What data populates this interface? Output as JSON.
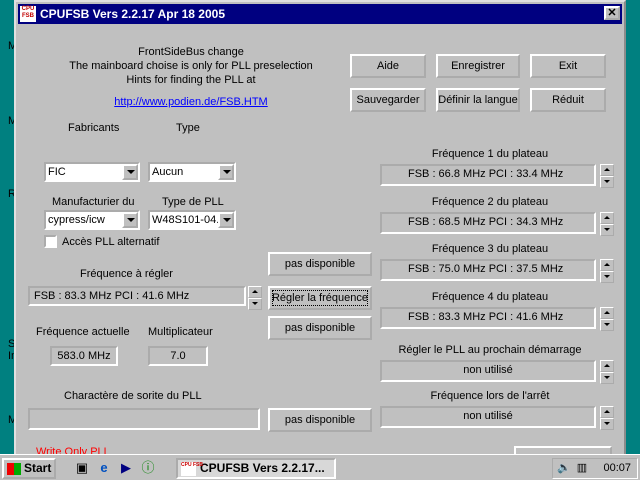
{
  "desktop": {
    "labels": [
      "My",
      "M",
      "R",
      "S",
      "In",
      "M"
    ]
  },
  "window": {
    "icon_text": "CPU FSB",
    "title": "CPUFSB  Vers 2.2.17   Apr 18 2005",
    "close_glyph": "✕"
  },
  "intro": {
    "line1": "FrontSideBus change",
    "line2": "The mainboard choise is only for PLL preselection",
    "line3": "Hints for finding the PLL at",
    "link": "http://www.podien.de/FSB.HTM"
  },
  "buttons": {
    "aide": "Aide",
    "enregistrer": "Enregistrer",
    "exit": "Exit",
    "sauvegarder": "Sauvegarder",
    "definir_langue": "Définir la langue",
    "reduit": "Réduit",
    "pas_disponible_1": "pas disponible",
    "regler_frequence": "Régler la fréquence",
    "pas_disponible_2": "pas disponible",
    "pas_disponible_3": "pas disponible"
  },
  "left": {
    "fabricants_label": "Fabricants",
    "type_label": "Type",
    "fabricant_value": "FIC",
    "type_value": "Aucun",
    "manufacturier_label": "Manufacturier du",
    "type_pll_label": "Type de PLL",
    "manufacturier_value": "cypress/icw",
    "type_pll_value": "W48S101-04..",
    "acces_pll_label": "Accès PLL alternatif",
    "acces_pll_checked": false,
    "freq_regler_label": "Fréquence à régler",
    "freq_regler_value": "FSB :  83.3 MHz  PCI :  41.6 MHz",
    "freq_actuelle_label": "Fréquence actuelle",
    "freq_actuelle_value": "583.0 MHz",
    "multiplicateur_label": "Multiplicateur",
    "multiplicateur_value": "7.0",
    "charactere_label": "Charactère de sorite du PLL",
    "charactere_value": "",
    "write_only_label": "Write Only PLL"
  },
  "right": {
    "plateau1_label": "Fréquence 1 du plateau",
    "plateau1_value": "FSB :  66.8 MHz  PCI :  33.4 MHz",
    "plateau2_label": "Fréquence 2 du plateau",
    "plateau2_value": "FSB :  68.5 MHz  PCI :  34.3 MHz",
    "plateau3_label": "Fréquence 3 du plateau",
    "plateau3_value": "FSB :  75.0 MHz  PCI :  37.5 MHz",
    "plateau4_label": "Fréquence 4 du plateau",
    "plateau4_value": "FSB :  83.3 MHz  PCI :  41.6 MHz",
    "prochain_label": "Régler le PLL au prochain démarrage",
    "prochain_value": "non utilisé",
    "arret_label": "Fréquence lors de l'arrêt",
    "arret_value": "non utilisé"
  },
  "taskbar": {
    "start_label": "Start",
    "task_icon_text": "CPU FSB",
    "task_label": "CPUFSB   Vers 2.2.17...",
    "clock": "00:07"
  },
  "colors": {
    "desktop": "#008080",
    "title_bar": "#000080",
    "face": "#c0c0c0",
    "link": "#0000ff",
    "write_only": "#ff0000"
  }
}
